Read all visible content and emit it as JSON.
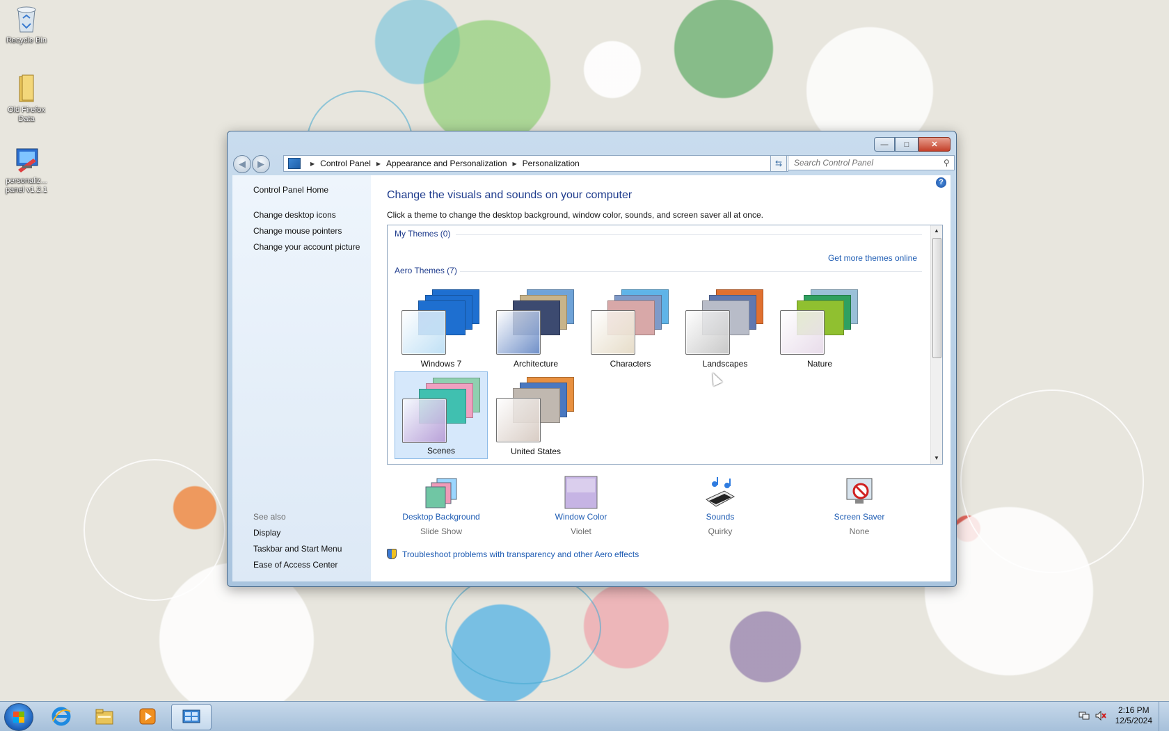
{
  "desktop": {
    "icons": [
      {
        "label": "Recycle Bin",
        "icon": "recycle-bin-icon"
      },
      {
        "label": "Old Firefox Data",
        "icon": "folder-icon"
      },
      {
        "label": "personaliz... panel v1.2.1",
        "icon": "personalization-panel-icon"
      }
    ]
  },
  "window": {
    "controls": {
      "minimize": "—",
      "maximize": "□",
      "close": "✕"
    },
    "breadcrumb": [
      "Control Panel",
      "Appearance and Personalization",
      "Personalization"
    ],
    "search_placeholder": "Search Control Panel",
    "sidebar": {
      "home": "Control Panel Home",
      "links": [
        "Change desktop icons",
        "Change mouse pointers",
        "Change your account picture"
      ],
      "see_also_label": "See also",
      "see_also": [
        "Display",
        "Taskbar and Start Menu",
        "Ease of Access Center"
      ]
    },
    "heading": "Change the visuals and sounds on your computer",
    "subheading": "Click a theme to change the desktop background, window color, sounds, and screen saver all at once.",
    "my_themes_label": "My Themes (0)",
    "get_more": "Get more themes online",
    "aero_label": "Aero Themes (7)",
    "themes": [
      {
        "name": "Windows 7",
        "selected": false,
        "glass": "#bfe0f5",
        "c1": "#1e6fd0",
        "c2": "#1e6fd0",
        "c3": "#1e6fd0"
      },
      {
        "name": "Architecture",
        "selected": false,
        "glass": "#6f8fc8",
        "c1": "#6fa3d8",
        "c2": "#c8b48a",
        "c3": "#3c4a70"
      },
      {
        "name": "Characters",
        "selected": false,
        "glass": "#e6dcc8",
        "c1": "#5fb4e8",
        "c2": "#7f9ac8",
        "c3": "#d8a8a8"
      },
      {
        "name": "Landscapes",
        "selected": false,
        "glass": "#c8c8c8",
        "c1": "#e07030",
        "c2": "#6078b0",
        "c3": "#b8bcc8"
      },
      {
        "name": "Nature",
        "selected": false,
        "glass": "#e8dcea",
        "c1": "#9ac0d8",
        "c2": "#2fa060",
        "c3": "#90c030"
      },
      {
        "name": "Scenes",
        "selected": true,
        "glass": "#b8a0d8",
        "c1": "#8fd0b0",
        "c2": "#f0a0c0",
        "c3": "#40c0b0"
      },
      {
        "name": "United States",
        "selected": false,
        "glass": "#d8ccc4",
        "c1": "#e89040",
        "c2": "#4a78c0",
        "c3": "#c0b8b0"
      }
    ],
    "options": [
      {
        "title": "Desktop Background",
        "value": "Slide Show",
        "icon": "desktop-background-icon"
      },
      {
        "title": "Window Color",
        "value": "Violet",
        "icon": "window-color-icon",
        "color": "#c6b4e4"
      },
      {
        "title": "Sounds",
        "value": "Quirky",
        "icon": "sounds-icon"
      },
      {
        "title": "Screen Saver",
        "value": "None",
        "icon": "screen-saver-icon"
      }
    ],
    "troubleshoot": "Troubleshoot problems with transparency and other Aero effects"
  },
  "taskbar": {
    "time": "2:16 PM",
    "date": "12/5/2024",
    "pinned": [
      "internet-explorer-icon",
      "windows-explorer-icon",
      "media-player-icon",
      "control-panel-icon"
    ]
  }
}
